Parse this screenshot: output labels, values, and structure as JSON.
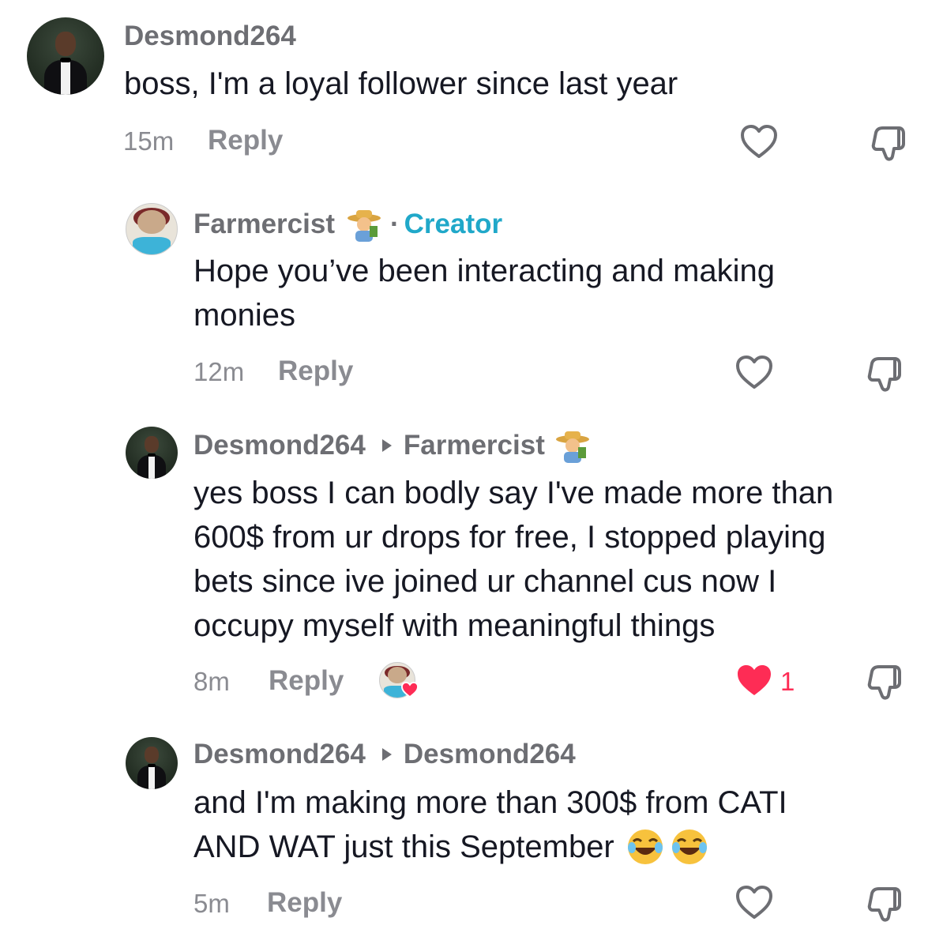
{
  "comments": [
    {
      "username": "Desmond264",
      "text": "boss, I'm a loyal follower since last year",
      "time": "15m",
      "reply_label": "Reply",
      "liked": false
    },
    {
      "username": "Farmercist",
      "creator_label": "Creator",
      "separator": "·",
      "text_line1": "Hope you’ve been interacting and making",
      "text_line2": "monies",
      "time": "12m",
      "reply_label": "Reply",
      "liked": false
    },
    {
      "username": "Desmond264",
      "reply_to": "Farmercist",
      "text_lines": [
        "yes boss I can bodly say I've made more than",
        "600$ from ur drops for free, I stopped playing",
        "bets since ive joined ur channel cus now I",
        "occupy myself with meaningful things"
      ],
      "time": "8m",
      "reply_label": "Reply",
      "liked": true,
      "like_count": "1",
      "creator_liked": true
    },
    {
      "username": "Desmond264",
      "reply_to": "Desmond264",
      "text_line1": "and I'm making more than 300$ from CATI",
      "text_line2": "AND WAT just this September",
      "time": "5m",
      "reply_label": "Reply",
      "liked": false
    }
  ],
  "colors": {
    "username": "#6d6e73",
    "creator": "#20a8c9",
    "text": "#161823",
    "meta": "#8a8b91",
    "like_red": "#fe2c55"
  },
  "icons": [
    "heart-outline-icon",
    "dislike-icon",
    "heart-filled-icon",
    "triangle-right-icon",
    "farmer-emoji-icon",
    "laughing-emoji-icon"
  ]
}
